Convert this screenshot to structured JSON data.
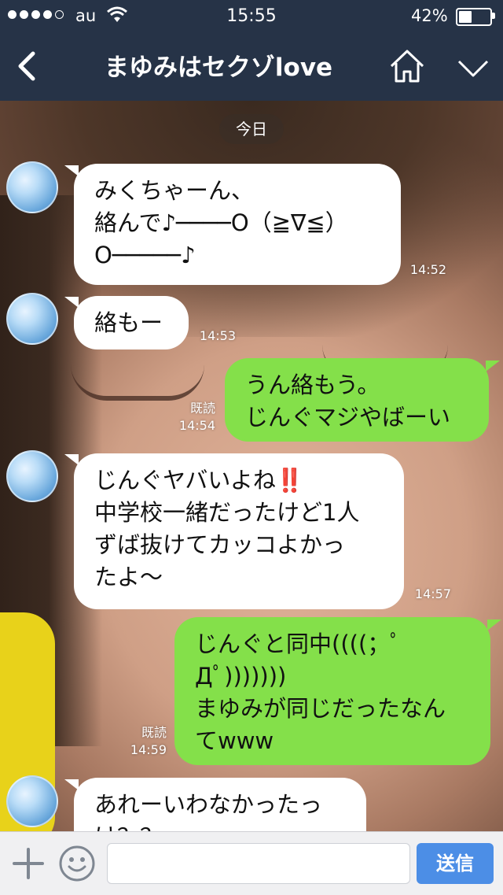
{
  "status_bar": {
    "carrier": "au",
    "time": "15:55",
    "battery_percent": "42%",
    "battery_level": 0.42,
    "signal_bars": 4
  },
  "header": {
    "title": "まゆみはセクゾlove",
    "back_icon": "chevron-left-icon",
    "home_icon": "home-icon",
    "menu_icon": "chevron-down-icon"
  },
  "date_label": "今日",
  "messages": [
    {
      "dir": "in",
      "text": "みくちゃーん、\n絡んで♪────O（≧∇≦）\nO─────♪",
      "time": "14:52"
    },
    {
      "dir": "in",
      "text": "絡もー",
      "time": "14:53"
    },
    {
      "dir": "out",
      "text": "うん絡もう。\nじんぐマジやばーい",
      "read": "既読",
      "time": "14:54"
    },
    {
      "dir": "in",
      "text_before_emoji": "じんぐヤバいよね",
      "emoji": "‼️",
      "text_after_emoji": "\n中学校一緒だったけど1人\nずば抜けてカッコよかっ\nたよ〜",
      "time": "14:57"
    },
    {
      "dir": "out",
      "text": "じんぐと同中((((；ﾟ\nДﾟ)))))))\nまゆみが同じだったなん\nてwww",
      "read": "既読",
      "time": "14:59"
    },
    {
      "dir": "in",
      "text": "あれーいわなかったっ\nけ？？",
      "time": ""
    }
  ],
  "input": {
    "placeholder": "",
    "send_label": "送信",
    "plus_icon": "plus-icon",
    "sticker_icon": "smiley-icon"
  },
  "colors": {
    "header_bg": "#263347",
    "outgoing_bubble": "#84e04a",
    "incoming_bubble": "#ffffff",
    "send_button": "#4c8ee6"
  }
}
